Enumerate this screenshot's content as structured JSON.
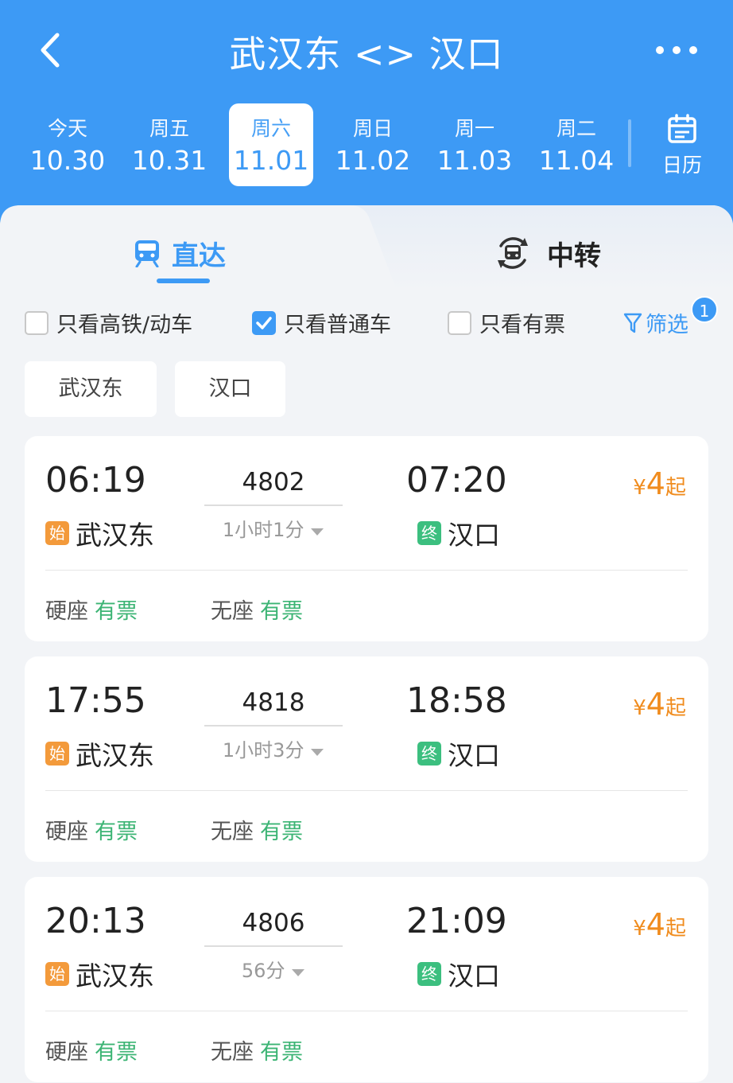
{
  "header": {
    "title": "武汉东 <> 汉口",
    "dates": [
      {
        "weekday": "今天",
        "date": "10.30",
        "active": false
      },
      {
        "weekday": "周五",
        "date": "10.31",
        "active": false
      },
      {
        "weekday": "周六",
        "date": "11.01",
        "active": true
      },
      {
        "weekday": "周日",
        "date": "11.02",
        "active": false
      },
      {
        "weekday": "周一",
        "date": "11.03",
        "active": false
      },
      {
        "weekday": "周二",
        "date": "11.04",
        "active": false
      }
    ],
    "calendar_label": "日历"
  },
  "tabs": {
    "direct": "直达",
    "transfer": "中转"
  },
  "filters": {
    "high_speed": {
      "label": "只看高铁/动车",
      "checked": false
    },
    "normal": {
      "label": "只看普通车",
      "checked": true
    },
    "available": {
      "label": "只看有票",
      "checked": false
    },
    "filter_label": "筛选",
    "filter_badge": "1"
  },
  "stations": {
    "from": "武汉东",
    "to": "汉口"
  },
  "trains": [
    {
      "dep_time": "06:19",
      "train_no": "4802",
      "duration": "1小时1分",
      "arr_time": "07:20",
      "start_badge": "始",
      "dep_station": "武汉东",
      "end_badge": "终",
      "arr_station": "汉口",
      "price_symbol": "¥",
      "price": "4",
      "price_suffix": "起",
      "seats": [
        {
          "type": "硬座",
          "status": "有票"
        },
        {
          "type": "无座",
          "status": "有票"
        }
      ]
    },
    {
      "dep_time": "17:55",
      "train_no": "4818",
      "duration": "1小时3分",
      "arr_time": "18:58",
      "start_badge": "始",
      "dep_station": "武汉东",
      "end_badge": "终",
      "arr_station": "汉口",
      "price_symbol": "¥",
      "price": "4",
      "price_suffix": "起",
      "seats": [
        {
          "type": "硬座",
          "status": "有票"
        },
        {
          "type": "无座",
          "status": "有票"
        }
      ]
    },
    {
      "dep_time": "20:13",
      "train_no": "4806",
      "duration": "56分",
      "arr_time": "21:09",
      "start_badge": "始",
      "dep_station": "武汉东",
      "end_badge": "终",
      "arr_station": "汉口",
      "price_symbol": "¥",
      "price": "4",
      "price_suffix": "起",
      "seats": [
        {
          "type": "硬座",
          "status": "有票"
        },
        {
          "type": "无座",
          "status": "有票"
        }
      ]
    }
  ],
  "colors": {
    "primary": "#3d9af5",
    "price": "#f08c1e",
    "available": "#3cb474",
    "start_badge": "#f39a3b",
    "end_badge": "#3cbf7f"
  }
}
